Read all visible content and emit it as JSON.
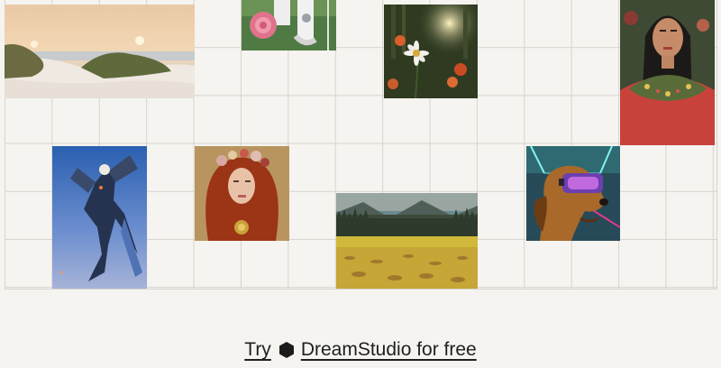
{
  "cta": {
    "prefix": "Try",
    "link_text": "DreamStudio for free",
    "logo_icon": "dreamstudio-logo-icon"
  },
  "gallery": {
    "images": [
      {
        "name": "beach-dunes-sunset-image"
      },
      {
        "name": "rose-astronaut-image"
      },
      {
        "name": "daisy-forest-image"
      },
      {
        "name": "frida-portrait-image"
      },
      {
        "name": "blue-robot-jumping-image"
      },
      {
        "name": "redhead-flower-crown-image"
      },
      {
        "name": "yellow-flower-field-image"
      },
      {
        "name": "dog-vr-headset-image"
      }
    ]
  }
}
